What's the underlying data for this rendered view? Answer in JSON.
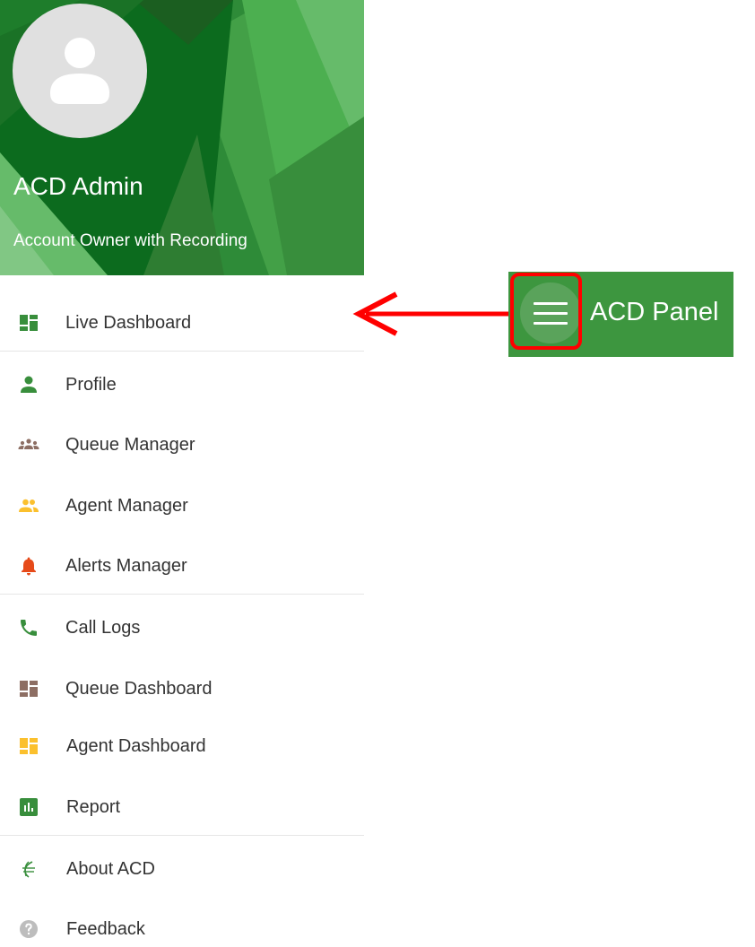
{
  "drawer": {
    "user_name": "ACD Admin",
    "user_role": "Account Owner with Recording",
    "avatar_icon": "person-icon",
    "menu": [
      {
        "label": "Live Dashboard",
        "icon": "dashboard-icon",
        "color": "#388e3c"
      },
      {
        "label": "Profile",
        "icon": "person-icon",
        "color": "#388e3c"
      },
      {
        "label": "Queue Manager",
        "icon": "groups-icon",
        "color": "#8d6e63"
      },
      {
        "label": "Agent Manager",
        "icon": "people-icon",
        "color": "#fbc02d"
      },
      {
        "label": "Alerts Manager",
        "icon": "bell-icon",
        "color": "#e64a19"
      },
      {
        "label": "Call Logs",
        "icon": "phone-icon",
        "color": "#388e3c"
      },
      {
        "label": "Queue Dashboard",
        "icon": "dashboard-icon",
        "color": "#8d6e63"
      },
      {
        "label": "Agent Dashboard",
        "icon": "dashboard-icon",
        "color": "#fbc02d"
      },
      {
        "label": "Report",
        "icon": "bar-chart-icon",
        "color": "#388e3c"
      },
      {
        "label": "About ACD",
        "icon": "acd-logo-icon",
        "color": "#388e3c"
      },
      {
        "label": "Feedback",
        "icon": "help-circle-icon",
        "color": "#bdbdbd"
      }
    ]
  },
  "toolbar": {
    "title": "ACD Panel",
    "menu_icon": "hamburger-icon",
    "background": "#3d963f"
  },
  "annotation": {
    "highlight_color": "#ff0000",
    "arrow_color": "#ff0000"
  }
}
